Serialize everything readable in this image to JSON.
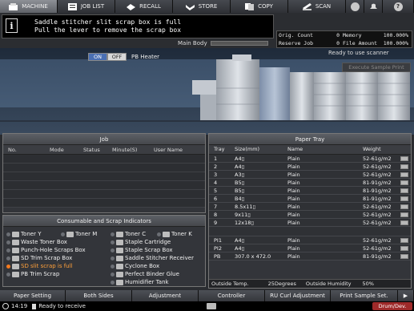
{
  "tabs": [
    {
      "label": "MACHINE",
      "icon": "machine-icon",
      "active": true
    },
    {
      "label": "JOB LIST",
      "icon": "list-icon",
      "active": false
    },
    {
      "label": "RECALL",
      "icon": "recall-icon",
      "active": false
    },
    {
      "label": "STORE",
      "icon": "store-icon",
      "active": false
    },
    {
      "label": "COPY",
      "icon": "copy-icon",
      "active": false
    },
    {
      "label": "SCAN",
      "icon": "scan-icon",
      "active": false
    }
  ],
  "help_label": "?",
  "message": {
    "line1": "Saddle stitcher slit scrap box is full",
    "line2": "Pull the lever to remove the scrap box"
  },
  "main_body_label": "Main Body",
  "counters": {
    "orig_count_label": "Orig. Count",
    "orig_count": "0",
    "memory_label": "Memory",
    "memory": "100.000%",
    "reserve_job_label": "Reserve Job",
    "reserve_job": "0",
    "file_amount_label": "File Amount",
    "file_amount": "100.000%"
  },
  "scanner_status": "Ready to use scanner",
  "execute_sample_label": "Execute Sample Print",
  "heater": {
    "on_label": "ON",
    "off_label": "OFF",
    "label": "PB Heater"
  },
  "job_panel": {
    "title": "Job",
    "headers": [
      "No.",
      "Mode",
      "Status",
      "Minute(S)",
      "User Name"
    ]
  },
  "consumables": {
    "title": "Consumable and Scrap Indicators",
    "items": [
      {
        "label": "Toner Y",
        "alert": false
      },
      {
        "label": "Toner M",
        "alert": false
      },
      {
        "label": "Toner C",
        "alert": false
      },
      {
        "label": "Toner K",
        "alert": false
      },
      {
        "label": "Waste Toner Box",
        "alert": false
      },
      {
        "label": "Staple Cartridge",
        "alert": false
      },
      {
        "label": "Punch-Hole Scraps Box",
        "alert": false
      },
      {
        "label": "Staple Scrap Box",
        "alert": false
      },
      {
        "label": "SD Trim Scrap Box",
        "alert": false
      },
      {
        "label": "Saddle Stitcher Receiver",
        "alert": false
      },
      {
        "label": "SD slit scrap is full",
        "alert": true
      },
      {
        "label": "Cyclone Box",
        "alert": false
      },
      {
        "label": "PB Trim Scrap",
        "alert": false
      },
      {
        "label": "Perfect Binder Glue",
        "alert": false
      },
      {
        "label": "Humidifier Tank",
        "alert": false
      }
    ]
  },
  "paper_tray": {
    "title": "Paper Tray",
    "headers": [
      "Tray",
      "Size(mm)",
      "Name",
      "Weight"
    ],
    "rows": [
      {
        "tray": "1",
        "size": "A4▯",
        "name": "Plain",
        "weight": "52-61g/m2"
      },
      {
        "tray": "2",
        "size": "A4▯",
        "name": "Plain",
        "weight": "52-61g/m2"
      },
      {
        "tray": "3",
        "size": "A3▯",
        "name": "Plain",
        "weight": "52-61g/m2"
      },
      {
        "tray": "4",
        "size": "B5▯",
        "name": "Plain",
        "weight": "81-91g/m2"
      },
      {
        "tray": "5",
        "size": "B5▯",
        "name": "Plain",
        "weight": "81-91g/m2"
      },
      {
        "tray": "6",
        "size": "B4▯",
        "name": "Plain",
        "weight": "81-91g/m2"
      },
      {
        "tray": "7",
        "size": "8.5x11▯",
        "name": "Plain",
        "weight": "52-61g/m2"
      },
      {
        "tray": "8",
        "size": "9x11▯",
        "name": "Plain",
        "weight": "52-61g/m2"
      },
      {
        "tray": "9",
        "size": "12x18▯",
        "name": "Plain",
        "weight": "52-61g/m2"
      }
    ],
    "extra_rows": [
      {
        "tray": "PI1",
        "size": "A4▯",
        "name": "Plain",
        "weight": "52-61g/m2"
      },
      {
        "tray": "PI2",
        "size": "A4▯",
        "name": "Plain",
        "weight": "52-61g/m2"
      },
      {
        "tray": "PB",
        "size": "307.0 x 472.0",
        "name": "Plain",
        "weight": "81-91g/m2"
      }
    ],
    "outside_temp_label": "Outside Temp.",
    "outside_temp": "25Degrees",
    "outside_humidity_label": "Outside Humidity",
    "outside_humidity": "50%"
  },
  "bottom_buttons": [
    "Paper Setting",
    "Both Sides",
    "Adjustment",
    "Controller",
    "RU Curl Adjustment",
    "Print Sample Set."
  ],
  "next_label": "▶",
  "status": {
    "time": "14:19",
    "text": "Ready to receive",
    "drum_label": "Drum/Dev."
  },
  "colors": {
    "alert": "#ffa03a",
    "active_toggle": "#4a6fb3",
    "drum": "#9e2a2a"
  }
}
